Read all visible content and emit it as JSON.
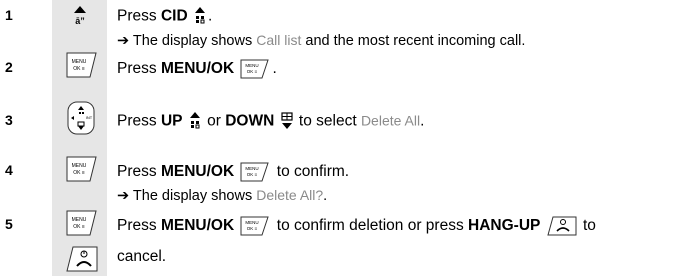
{
  "steps": [
    {
      "number": "1",
      "line_a": "Press ",
      "bold_a": "CID",
      "line_end": ".",
      "sub_arrow": "➔",
      "sub_a": " The display shows ",
      "sub_grey": "Call list",
      "sub_b": " and the most recent incoming call."
    },
    {
      "number": "2",
      "line_a": "Press ",
      "bold_a": "MENU/OK",
      "line_end": "."
    },
    {
      "number": "3",
      "line_a": "Press ",
      "bold_a": "UP",
      "mid_a": " or ",
      "bold_b": "DOWN",
      "mid_b": " to select ",
      "grey": "Delete All",
      "line_end": "."
    },
    {
      "number": "4",
      "line_a": "Press ",
      "bold_a": "MENU/OK",
      "mid_a": " to confirm.",
      "sub_arrow": "➔",
      "sub_a": " The display shows ",
      "sub_grey": "Delete All?",
      "sub_b": "."
    },
    {
      "number": "5",
      "line_a": "Press ",
      "bold_a": "MENU/OK",
      "mid_a": " to confirm deletion or press ",
      "bold_b": "HANG-UP",
      "mid_b": " to",
      "line2": "cancel."
    }
  ],
  "icons": {
    "menu_key_top": "MENU",
    "menu_key_bottom": "OK ≡",
    "cid": "cid-icon",
    "up": "up-icon",
    "down": "down-icon",
    "hangup": "hang-up-icon",
    "nav": "nav-key-icon"
  },
  "colors": {
    "strip": "#e6e6e6",
    "grey_text": "#8a8a8a"
  }
}
